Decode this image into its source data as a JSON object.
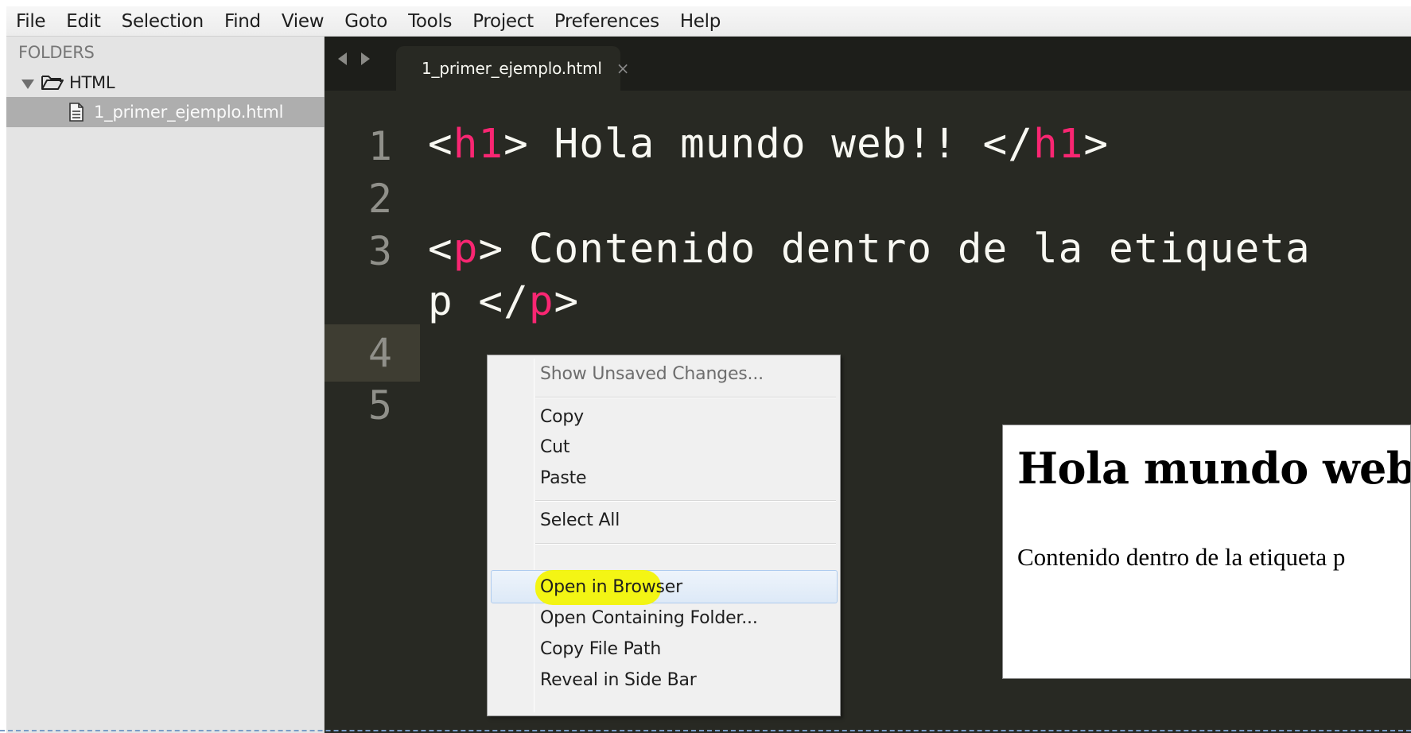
{
  "menubar": {
    "items": [
      "File",
      "Edit",
      "Selection",
      "Find",
      "View",
      "Goto",
      "Tools",
      "Project",
      "Preferences",
      "Help"
    ]
  },
  "sidebar": {
    "heading": "FOLDERS",
    "folder": {
      "name": "HTML",
      "icon": "folder-open-icon",
      "expanded": true
    },
    "files": [
      {
        "name": "1_primer_ejemplo.html",
        "icon": "file-icon",
        "selected": true
      }
    ]
  },
  "editor": {
    "tab": {
      "label": "1_primer_ejemplo.html",
      "close": "×"
    },
    "line_numbers": [
      "1",
      "2",
      "3",
      "4",
      "5"
    ],
    "current_line": "4",
    "code": {
      "line1": {
        "open": "<",
        "tag": "h1",
        "mid": "> Hola mundo web!! </",
        "tag2": "h1",
        "close": ">"
      },
      "line3a": {
        "open": "<",
        "tag": "p",
        "mid": "> Contenido dentro de la etiqueta"
      },
      "line3b": {
        "text": "p </",
        "tag": "p",
        "close": ">"
      }
    },
    "colors": {
      "background": "#282923",
      "tag": "#f92672",
      "text": "#f8f8f2",
      "gutter": "#90908a"
    }
  },
  "context_menu": {
    "items": [
      {
        "label": "Show Unsaved Changes...",
        "enabled": false
      },
      {
        "label": "Copy",
        "enabled": true
      },
      {
        "label": "Cut",
        "enabled": true
      },
      {
        "label": "Paste",
        "enabled": true
      },
      {
        "label": "Select All",
        "enabled": true
      },
      {
        "label": "Open in Browser",
        "enabled": true,
        "highlighted": true
      },
      {
        "label": "Open Containing Folder...",
        "enabled": true
      },
      {
        "label": "Copy File Path",
        "enabled": true
      },
      {
        "label": "Reveal in Side Bar",
        "enabled": true
      }
    ],
    "highlight_color": "#f4f500"
  },
  "browser_preview": {
    "heading": "Hola mundo web!!",
    "paragraph": "Contenido dentro de la etiqueta p"
  }
}
